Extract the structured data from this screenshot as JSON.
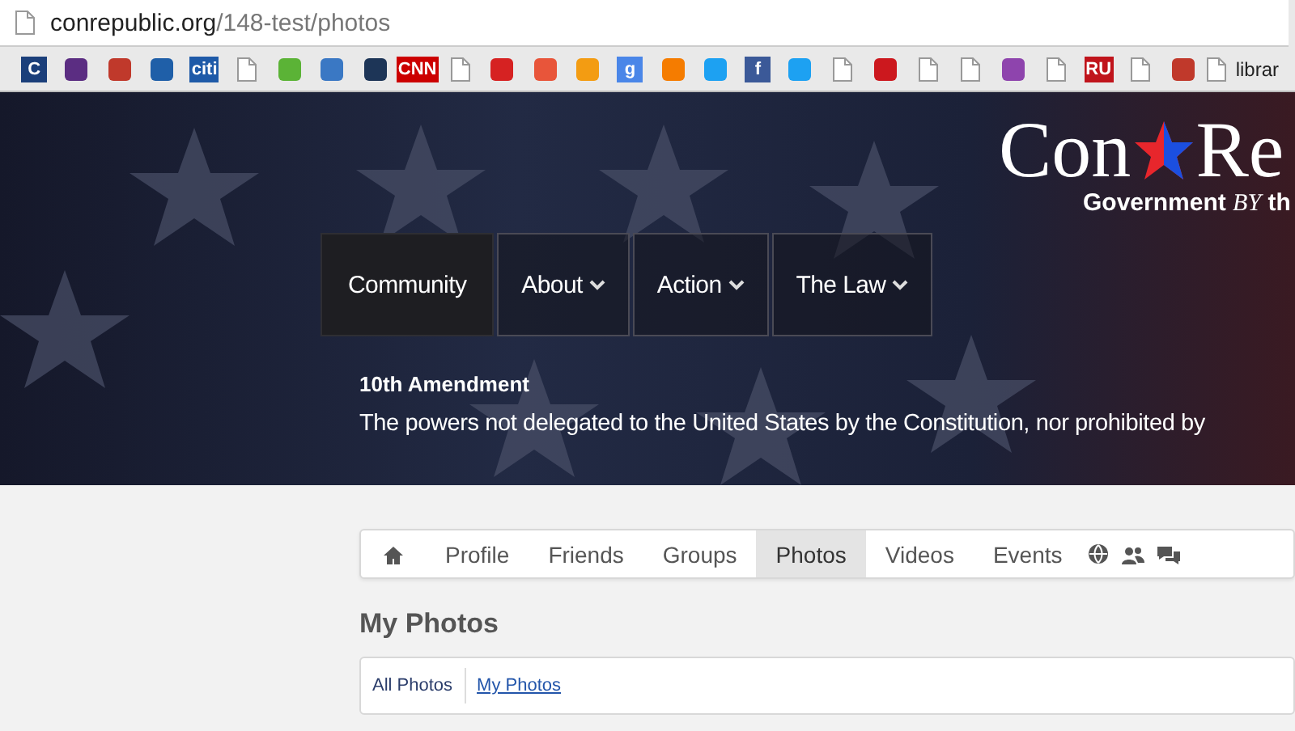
{
  "browser": {
    "url_host": "conrepublic.org",
    "url_path": "/148-test/photos",
    "bookmarks": [
      {
        "kind": "letter",
        "label": "C",
        "color": "#1b3f7a"
      },
      {
        "kind": "glyph",
        "color": "#5b2d82"
      },
      {
        "kind": "glyph",
        "color": "#c0392b"
      },
      {
        "kind": "glyph",
        "color": "#1f5fa8"
      },
      {
        "kind": "letter",
        "label": "citi",
        "color": "#1e5aa8"
      },
      {
        "kind": "page"
      },
      {
        "kind": "glyph",
        "color": "#5bb336"
      },
      {
        "kind": "glyph",
        "color": "#3a78c4"
      },
      {
        "kind": "glyph",
        "color": "#1d3557"
      },
      {
        "kind": "letter",
        "label": "CNN",
        "color": "#cc0000"
      },
      {
        "kind": "page"
      },
      {
        "kind": "glyph",
        "color": "#d62222"
      },
      {
        "kind": "glyph",
        "color": "#e8553a"
      },
      {
        "kind": "glyph",
        "color": "#f39c12"
      },
      {
        "kind": "letter",
        "label": "g",
        "color": "#4a86e8"
      },
      {
        "kind": "glyph",
        "color": "#f57c00"
      },
      {
        "kind": "glyph",
        "color": "#1da1f2"
      },
      {
        "kind": "letter",
        "label": "f",
        "color": "#3b5998"
      },
      {
        "kind": "glyph",
        "color": "#1da1f2"
      },
      {
        "kind": "page"
      },
      {
        "kind": "glyph",
        "color": "#cc181e"
      },
      {
        "kind": "page"
      },
      {
        "kind": "page"
      },
      {
        "kind": "glyph",
        "color": "#8e44ad"
      },
      {
        "kind": "page"
      },
      {
        "kind": "letter",
        "label": "RU",
        "color": "#c0141c"
      },
      {
        "kind": "page"
      },
      {
        "kind": "glyph",
        "color": "#c0392b"
      },
      {
        "kind": "page",
        "label": "librar"
      }
    ]
  },
  "banner": {
    "logo_left": "Con",
    "logo_right": "Re",
    "tagline": "Government *BY* th",
    "menu": [
      {
        "label": "Community",
        "selected": true,
        "dropdown": false
      },
      {
        "label": "About",
        "selected": false,
        "dropdown": true
      },
      {
        "label": "Action",
        "selected": false,
        "dropdown": true
      },
      {
        "label": "The Law",
        "selected": false,
        "dropdown": true
      }
    ],
    "quote_title": "10th Amendment",
    "quote_text": "The powers not delegated to the United States by the Constitution, nor prohibited by"
  },
  "profile_tabs": [
    {
      "kind": "home",
      "selected": false
    },
    {
      "kind": "text",
      "label": "Profile",
      "selected": false
    },
    {
      "kind": "text",
      "label": "Friends",
      "selected": false
    },
    {
      "kind": "text",
      "label": "Groups",
      "selected": false
    },
    {
      "kind": "text",
      "label": "Photos",
      "selected": true
    },
    {
      "kind": "text",
      "label": "Videos",
      "selected": false
    },
    {
      "kind": "text",
      "label": "Events",
      "selected": false
    },
    {
      "kind": "globe",
      "selected": false
    },
    {
      "kind": "people",
      "selected": false
    },
    {
      "kind": "chat",
      "selected": false
    }
  ],
  "heading": "My Photos",
  "filters": [
    {
      "label": "All Photos",
      "selected": false
    },
    {
      "label": "My Photos",
      "selected": true
    }
  ]
}
